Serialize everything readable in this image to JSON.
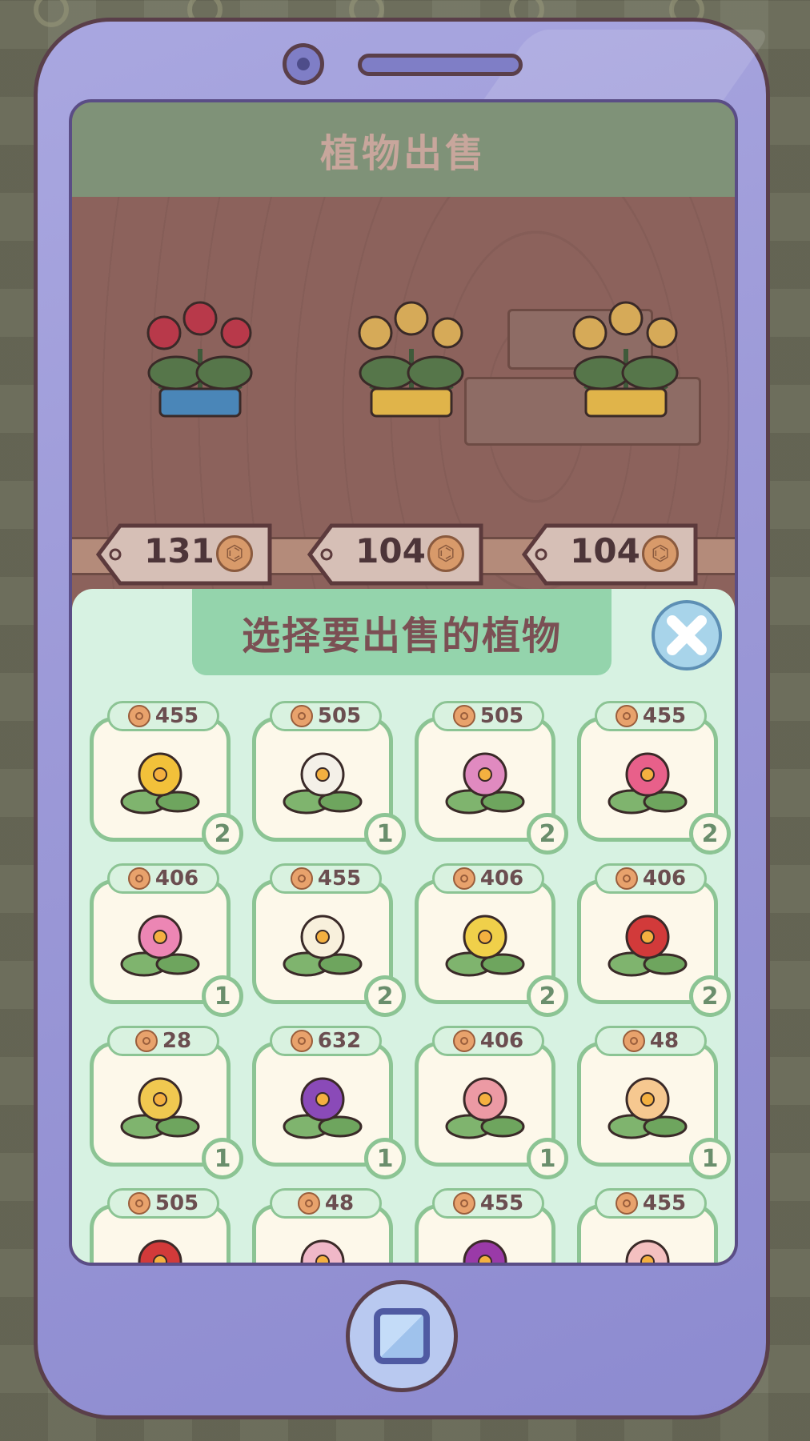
{
  "header": {
    "title": "植物出售"
  },
  "shelf_items": [
    {
      "price": "131",
      "flower_icon": "red-rose-bouquet-icon",
      "bow_color": "#4a86b8",
      "bloom_color": "#b8394a"
    },
    {
      "price": "104",
      "flower_icon": "yellow-rose-bouquet-icon",
      "bow_color": "#e0b44a",
      "bloom_color": "#d6aa58"
    },
    {
      "price": "104",
      "flower_icon": "yellow-rose-bouquet-icon",
      "bow_color": "#e0b44a",
      "bloom_color": "#d6aa58"
    }
  ],
  "panel": {
    "title": "选择要出售的植物",
    "close_icon": "close-icon",
    "plants": [
      {
        "price": "455",
        "count": "2",
        "icon": "yellow-daffodil-icon",
        "color": "#f2c13a"
      },
      {
        "price": "505",
        "count": "1",
        "icon": "white-hydrangea-icon",
        "color": "#f4f0e8"
      },
      {
        "price": "505",
        "count": "2",
        "icon": "pink-hydrangea-icon",
        "color": "#e08ac0"
      },
      {
        "price": "455",
        "count": "2",
        "icon": "pink-anthurium-icon",
        "color": "#e8608a"
      },
      {
        "price": "406",
        "count": "1",
        "icon": "pink-lotus-icon",
        "color": "#ec86b4"
      },
      {
        "price": "455",
        "count": "2",
        "icon": "white-daffodil-icon",
        "color": "#f8f0dc"
      },
      {
        "price": "406",
        "count": "2",
        "icon": "yellow-tulip-icon",
        "color": "#f0d04a"
      },
      {
        "price": "406",
        "count": "2",
        "icon": "red-lotus-icon",
        "color": "#d23a3a"
      },
      {
        "price": "28",
        "count": "1",
        "icon": "yellow-hyacinth-icon",
        "color": "#f0c850"
      },
      {
        "price": "632",
        "count": "1",
        "icon": "purple-violet-icon",
        "color": "#8a4ab8"
      },
      {
        "price": "406",
        "count": "1",
        "icon": "pink-tulip-icon",
        "color": "#ec9aa4"
      },
      {
        "price": "48",
        "count": "1",
        "icon": "yellow-lily-icon",
        "color": "#f6c890"
      },
      {
        "price": "505",
        "count": "",
        "icon": "red-flower-icon",
        "color": "#d23a3a"
      },
      {
        "price": "48",
        "count": "",
        "icon": "pink-blossom-icon",
        "color": "#f0b8c8"
      },
      {
        "price": "455",
        "count": "",
        "icon": "purple-iris-icon",
        "color": "#9a3aa8"
      },
      {
        "price": "455",
        "count": "",
        "icon": "white-pink-flower-icon",
        "color": "#f4c0c0"
      }
    ]
  },
  "colors": {
    "phone_body": "#9d9ad8",
    "panel_bg": "#d7f2e2",
    "card_border": "#8cc494",
    "title_bar": "#7f9278"
  }
}
